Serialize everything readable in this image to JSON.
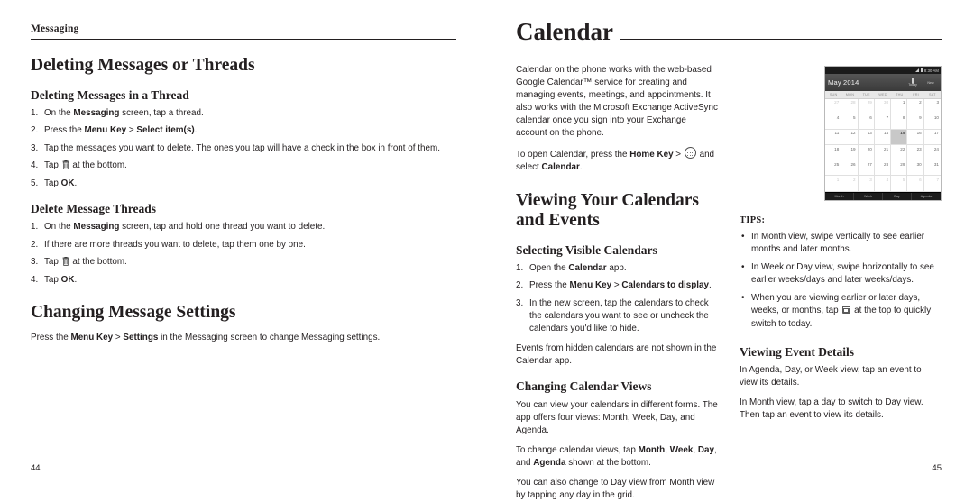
{
  "left_page": {
    "running_head": "Messaging",
    "folio": "44",
    "sections": [
      {
        "heading": "Deleting Messages or Threads",
        "subsections": [
          {
            "heading": "Deleting Messages in a Thread",
            "steps": [
              "On the Messaging screen, tap a thread.",
              "Press the Menu Key > Select item(s).",
              "Tap the messages you want to delete. The ones you tap will have a check in the box in front of them.",
              "Tap  at the bottom.",
              "Tap OK."
            ]
          },
          {
            "heading": "Delete Message Threads",
            "steps": [
              "On the Messaging screen, tap and hold one thread you want to delete.",
              "If there are more threads you want to delete, tap them one by one.",
              "Tap  at the bottom.",
              "Tap OK."
            ]
          }
        ]
      },
      {
        "heading": "Changing Message Settings",
        "paragraph": "Press the Menu Key > Settings in the Messaging screen to change Messaging settings."
      }
    ]
  },
  "right_page": {
    "chapter_title": "Calendar",
    "folio": "45",
    "intro_paragraph_1": "Calendar on the phone works with the web-based Google Calendar™ service for creating and managing events, meetings, and appointments. It also works with the Microsoft Exchange ActiveSync calendar once you sign into your Exchange account on the phone.",
    "intro_paragraph_2_prefix": "To open Calendar, press the ",
    "intro_paragraph_2_bold": "Home Key",
    "intro_paragraph_2_mid": " > ",
    "intro_paragraph_2_suffix": " and select ",
    "intro_paragraph_2_bold2": "Calendar",
    "section_viewing": {
      "heading": "Viewing Your Calendars and Events",
      "subsection_selecting": {
        "heading": "Selecting Visible Calendars",
        "steps": [
          "Open the Calendar app.",
          "Press the Menu Key > Calendars to display.",
          "In the new screen, tap the calendars to check the calendars you want to see or uncheck the calendars you'd like to hide."
        ],
        "note": "Events from hidden calendars are not shown in the Calendar app."
      },
      "subsection_views": {
        "heading": "Changing Calendar Views",
        "paragraph_1": "You can view your calendars in different forms. The app offers four views: Month, Week, Day, and Agenda.",
        "paragraph_2_prefix": "To change calendar views, tap ",
        "paragraph_2_items": "Month, Week, Day, and Agenda",
        "paragraph_2_suffix": " shown at the bottom.",
        "paragraph_3": "You can also change to Day view from Month view by tapping any day in the grid."
      }
    },
    "tips": {
      "label": "TIPS:",
      "items": [
        "In Month view, swipe vertically to see earlier months and later months.",
        "In Week or Day view, swipe horizontally to see earlier weeks/days and later weeks/days.",
        "When you are viewing earlier or later days, weeks, or months, tap  at the top to quickly switch to today."
      ]
    },
    "section_event_details": {
      "heading": "Viewing Event Details",
      "paragraph_1": "In Agenda, Day, or Week view, tap an event to view its details.",
      "paragraph_2": "In Month view, tap a day to switch to Day view. Then tap an event to view its details."
    },
    "phone_screenshot": {
      "status_time": "8:30 AM",
      "month_title": "May 2014",
      "action_today": "Today",
      "action_new": "New",
      "day_headers": [
        "SUN",
        "MON",
        "TUE",
        "WED",
        "THU",
        "FRI",
        "SAT"
      ],
      "days": [
        {
          "n": "27",
          "dim": true
        },
        {
          "n": "28",
          "dim": true
        },
        {
          "n": "29",
          "dim": true
        },
        {
          "n": "30",
          "dim": true
        },
        {
          "n": "1"
        },
        {
          "n": "2"
        },
        {
          "n": "3"
        },
        {
          "n": "4"
        },
        {
          "n": "5"
        },
        {
          "n": "6"
        },
        {
          "n": "7"
        },
        {
          "n": "8"
        },
        {
          "n": "9"
        },
        {
          "n": "10"
        },
        {
          "n": "11"
        },
        {
          "n": "12"
        },
        {
          "n": "13"
        },
        {
          "n": "14"
        },
        {
          "n": "15",
          "selected": true
        },
        {
          "n": "16"
        },
        {
          "n": "17"
        },
        {
          "n": "18"
        },
        {
          "n": "19"
        },
        {
          "n": "20"
        },
        {
          "n": "21"
        },
        {
          "n": "22"
        },
        {
          "n": "23"
        },
        {
          "n": "24"
        },
        {
          "n": "25"
        },
        {
          "n": "26"
        },
        {
          "n": "27"
        },
        {
          "n": "28"
        },
        {
          "n": "29"
        },
        {
          "n": "30"
        },
        {
          "n": "31"
        },
        {
          "n": "1",
          "dim": true
        },
        {
          "n": "2",
          "dim": true
        },
        {
          "n": "3",
          "dim": true
        },
        {
          "n": "4",
          "dim": true
        },
        {
          "n": "5",
          "dim": true
        },
        {
          "n": "6",
          "dim": true
        },
        {
          "n": "7",
          "dim": true
        }
      ],
      "tabs": [
        "Month",
        "Week",
        "Day",
        "Agenda"
      ]
    }
  }
}
